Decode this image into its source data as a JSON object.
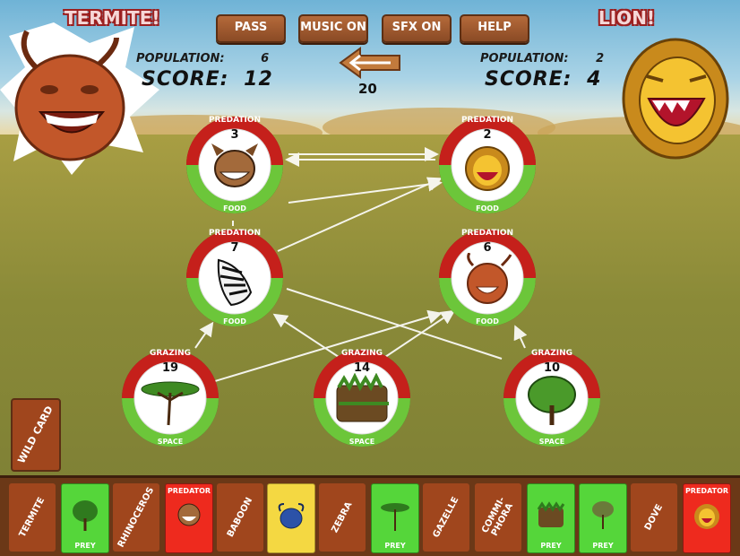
{
  "buttons": {
    "pass": "PASS",
    "music": "MUSIC ON",
    "sfx": "SFX ON",
    "help": "HELP"
  },
  "player1": {
    "name": "TERMITE!",
    "population_label": "POPULATION:",
    "population": "6",
    "score_label": "SCORE:",
    "score": "12"
  },
  "player2": {
    "name": "LION!",
    "population_label": "POPULATION:",
    "population": "2",
    "score_label": "SCORE:",
    "score": "4"
  },
  "turn": {
    "value": "20"
  },
  "nodes": {
    "hyena": {
      "top": "PREDATION",
      "num": "3",
      "bottom": "FOOD"
    },
    "lion": {
      "top": "PREDATION",
      "num": "2",
      "bottom": "FOOD"
    },
    "zebra": {
      "top": "PREDATION",
      "num": "7",
      "bottom": "FOOD"
    },
    "termite": {
      "top": "PREDATION",
      "num": "6",
      "bottom": "FOOD"
    },
    "acacia": {
      "top": "GRAZING",
      "num": "19",
      "bottom": "SPACE"
    },
    "grass": {
      "top": "GRAZING",
      "num": "14",
      "bottom": "SPACE"
    },
    "tree": {
      "top": "GRAZING",
      "num": "10",
      "bottom": "SPACE"
    }
  },
  "wild_card": "WILD CARD",
  "hand": {
    "termite": "TERMITE",
    "rhinoceros": "RHINOCEROS",
    "baboon": "BABOON",
    "zebra": "ZEBRA",
    "gazelle": "GAZELLE",
    "commiphora": "COMMI-\nPHORA",
    "dove": "DOVE",
    "prey": "PREY",
    "predator": "PREDATOR"
  },
  "colors": {
    "wood": "#a0461d",
    "prey": "#55d63a",
    "predator": "#ee2a1e",
    "ring_red": "#c5201b",
    "ring_green": "#6cc63a"
  }
}
